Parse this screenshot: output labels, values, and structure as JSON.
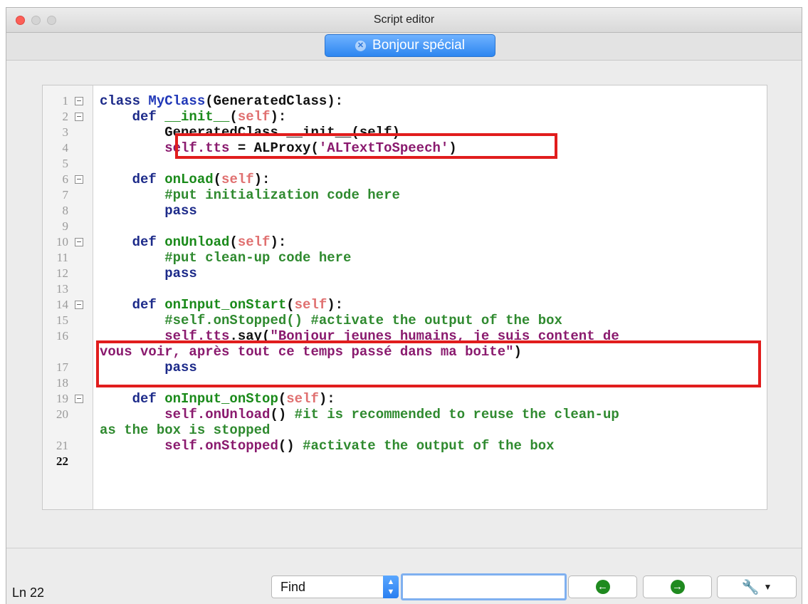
{
  "window": {
    "title": "Script editor",
    "tab_label": "Bonjour spécial"
  },
  "editor": {
    "lines": [
      {
        "num": "1",
        "fold": true,
        "segs": [
          {
            "t": "class ",
            "c": "kw"
          },
          {
            "t": "MyClass",
            "c": "cls"
          },
          {
            "t": "(GeneratedClass):",
            "c": ""
          }
        ]
      },
      {
        "num": "2",
        "fold": true,
        "segs": [
          {
            "t": "    def ",
            "c": "kw"
          },
          {
            "t": "__init__",
            "c": "fn"
          },
          {
            "t": "(",
            "c": ""
          },
          {
            "t": "self",
            "c": "slf"
          },
          {
            "t": "):",
            "c": ""
          }
        ]
      },
      {
        "num": "3",
        "fold": false,
        "segs": [
          {
            "t": "        GeneratedClass.__init__(self)",
            "c": ""
          }
        ]
      },
      {
        "num": "4",
        "fold": false,
        "segs": [
          {
            "t": "        self.tts",
            "c": "attr"
          },
          {
            "t": " = ALProxy(",
            "c": ""
          },
          {
            "t": "'ALTextToSpeech'",
            "c": "str"
          },
          {
            "t": ")",
            "c": ""
          }
        ]
      },
      {
        "num": "5",
        "fold": false,
        "segs": []
      },
      {
        "num": "6",
        "fold": true,
        "segs": [
          {
            "t": "    def ",
            "c": "kw"
          },
          {
            "t": "onLoad",
            "c": "fn"
          },
          {
            "t": "(",
            "c": ""
          },
          {
            "t": "self",
            "c": "slf"
          },
          {
            "t": "):",
            "c": ""
          }
        ]
      },
      {
        "num": "7",
        "fold": false,
        "segs": [
          {
            "t": "        #put initialization code here",
            "c": "cm"
          }
        ]
      },
      {
        "num": "8",
        "fold": false,
        "segs": [
          {
            "t": "        pass",
            "c": "kw"
          }
        ]
      },
      {
        "num": "9",
        "fold": false,
        "segs": []
      },
      {
        "num": "10",
        "fold": true,
        "segs": [
          {
            "t": "    def ",
            "c": "kw"
          },
          {
            "t": "onUnload",
            "c": "fn"
          },
          {
            "t": "(",
            "c": ""
          },
          {
            "t": "self",
            "c": "slf"
          },
          {
            "t": "):",
            "c": ""
          }
        ]
      },
      {
        "num": "11",
        "fold": false,
        "segs": [
          {
            "t": "        #put clean-up code here",
            "c": "cm"
          }
        ]
      },
      {
        "num": "12",
        "fold": false,
        "segs": [
          {
            "t": "        pass",
            "c": "kw"
          }
        ]
      },
      {
        "num": "13",
        "fold": false,
        "segs": []
      },
      {
        "num": "14",
        "fold": true,
        "segs": [
          {
            "t": "    def ",
            "c": "kw"
          },
          {
            "t": "onInput_onStart",
            "c": "fn"
          },
          {
            "t": "(",
            "c": ""
          },
          {
            "t": "self",
            "c": "slf"
          },
          {
            "t": "):",
            "c": ""
          }
        ]
      },
      {
        "num": "15",
        "fold": false,
        "segs": [
          {
            "t": "        #self.onStopped() #activate the output of the box",
            "c": "cm"
          }
        ]
      },
      {
        "num": "16",
        "fold": false,
        "segs": [
          {
            "t": "        self.tts",
            "c": "attr"
          },
          {
            "t": ".say(",
            "c": ""
          },
          {
            "t": "\"Bonjour jeunes humains, je suis content de",
            "c": "str"
          }
        ]
      },
      {
        "num": "",
        "fold": false,
        "segs": [
          {
            "t": "vous voir, après tout ce temps passé dans ma boite\"",
            "c": "str"
          },
          {
            "t": ")",
            "c": ""
          }
        ]
      },
      {
        "num": "17",
        "fold": false,
        "segs": [
          {
            "t": "        pass",
            "c": "kw"
          }
        ]
      },
      {
        "num": "18",
        "fold": false,
        "segs": []
      },
      {
        "num": "19",
        "fold": true,
        "segs": [
          {
            "t": "    def ",
            "c": "kw"
          },
          {
            "t": "onInput_onStop",
            "c": "fn"
          },
          {
            "t": "(",
            "c": ""
          },
          {
            "t": "self",
            "c": "slf"
          },
          {
            "t": "):",
            "c": ""
          }
        ]
      },
      {
        "num": "20",
        "fold": false,
        "segs": [
          {
            "t": "        self.onUnload",
            "c": "attr"
          },
          {
            "t": "() ",
            "c": ""
          },
          {
            "t": "#it is recommended to reuse the clean-up",
            "c": "cm"
          }
        ]
      },
      {
        "num": "",
        "fold": false,
        "segs": [
          {
            "t": "as the box is stopped",
            "c": "cm"
          }
        ]
      },
      {
        "num": "21",
        "fold": false,
        "segs": [
          {
            "t": "        self.onStopped",
            "c": "attr"
          },
          {
            "t": "() ",
            "c": ""
          },
          {
            "t": "#activate the output of the box",
            "c": "cm"
          }
        ]
      },
      {
        "num": "22",
        "fold": false,
        "current": true,
        "segs": []
      }
    ]
  },
  "statusbar": {
    "line_info": "Ln 22",
    "find_option": "Find",
    "find_value": "",
    "prev_icon": "arrow-left-icon",
    "next_icon": "arrow-right-icon",
    "tools_icon": "wrench-icon"
  },
  "colors": {
    "accent": "#2d86f0",
    "highlight": "#e11d1d"
  }
}
